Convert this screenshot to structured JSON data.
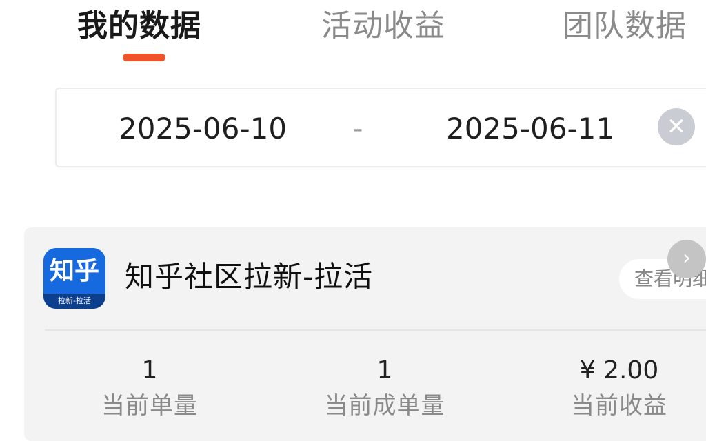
{
  "tabs": [
    {
      "label": "我的数据",
      "active": true
    },
    {
      "label": "活动收益",
      "active": false
    },
    {
      "label": "团队数据",
      "active": false
    }
  ],
  "date_range": {
    "start": "2025-06-10",
    "separator": "-",
    "end": "2025-06-11",
    "clear_icon": "close-circle-icon",
    "clear_glyph": "✕"
  },
  "activity_card": {
    "app_icon": {
      "text": "知乎",
      "subtext": "拉新-拉活",
      "color": "#1769e0"
    },
    "title": "知乎社区拉新-拉活",
    "detail_button": "查看明细",
    "stats": [
      {
        "value": "1",
        "label": "当前单量"
      },
      {
        "value": "1",
        "label": "当前成单量"
      },
      {
        "value": "¥ 2.00",
        "label": "当前收益"
      }
    ]
  },
  "nav_next": {
    "icon": "chevron-right-icon",
    "glyph": "›"
  },
  "colors": {
    "accent": "#f0532a",
    "brand": "#1769e0"
  }
}
